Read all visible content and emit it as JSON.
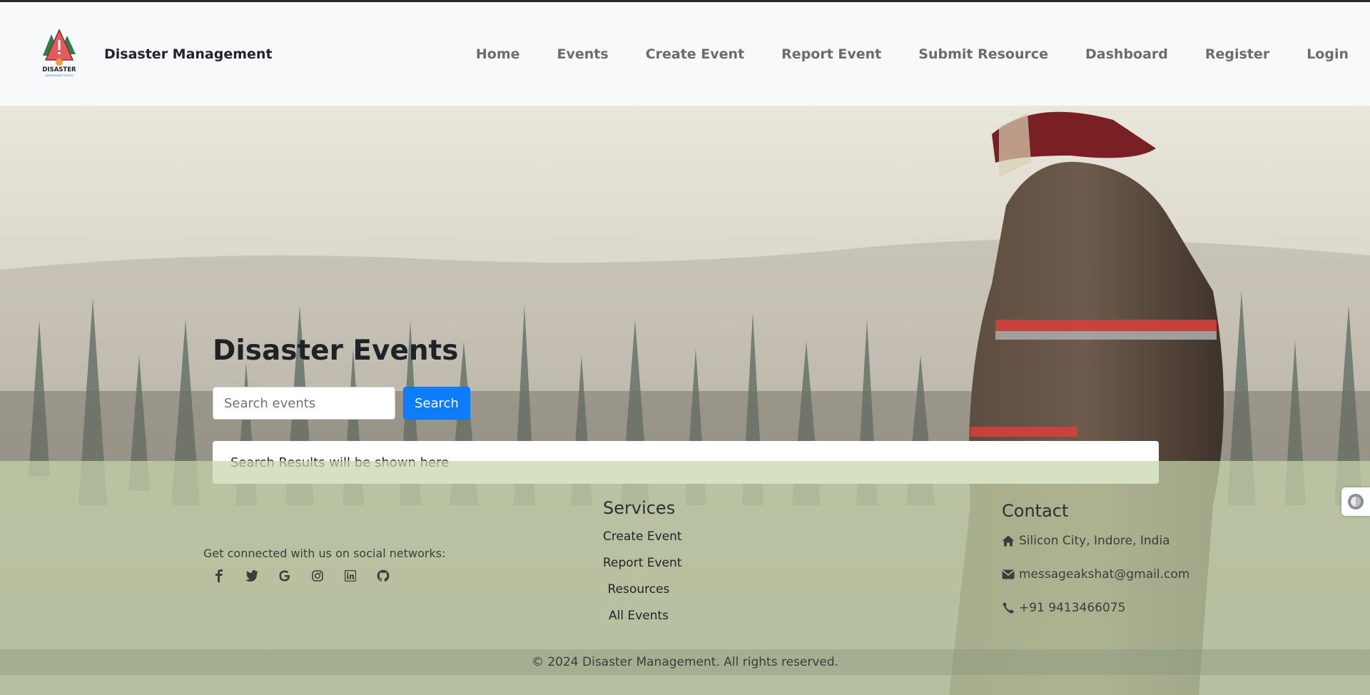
{
  "brand": {
    "name": "Disaster Management",
    "logo_text": "DISASTER",
    "logo_subtext": "MANAGEMENT SYSTEM"
  },
  "nav": {
    "items": [
      {
        "label": "Home"
      },
      {
        "label": "Events"
      },
      {
        "label": "Create Event"
      },
      {
        "label": "Report Event"
      },
      {
        "label": "Submit Resource"
      },
      {
        "label": "Dashboard"
      },
      {
        "label": "Register"
      },
      {
        "label": "Login"
      }
    ]
  },
  "hero": {
    "title": "Disaster Events",
    "search_placeholder": "Search events",
    "search_button": "Search",
    "results_text": "Search Results will be shown here"
  },
  "footer": {
    "social_text": "Get connected with us on social networks:",
    "social_icons": [
      "facebook-icon",
      "twitter-icon",
      "google-icon",
      "instagram-icon",
      "linkedin-icon",
      "github-icon"
    ],
    "services": {
      "title": "Services",
      "links": [
        {
          "label": "Create Event"
        },
        {
          "label": "Report Event"
        },
        {
          "label": "Resources"
        },
        {
          "label": "All Events"
        }
      ]
    },
    "contact": {
      "title": "Contact",
      "address": "Silicon City, Indore, India",
      "email": "messageakshat@gmail.com",
      "phone": "+91 9413466075"
    },
    "copyright": "© 2024 Disaster Management. All rights reserved."
  },
  "colors": {
    "primary": "#0d7dfd",
    "navbar_bg": "#f8f9fa",
    "nav_text": "#6c6c6c",
    "footer_overlay": "#c6d4ac"
  }
}
